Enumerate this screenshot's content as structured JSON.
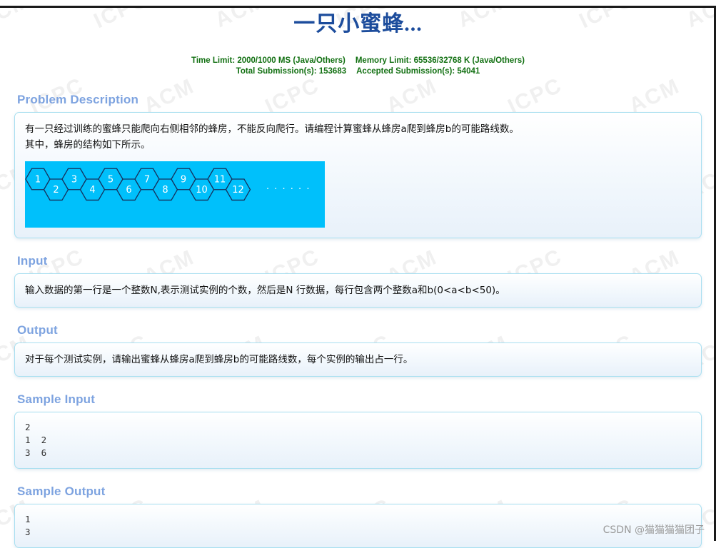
{
  "page": {
    "title": "一只小蜜蜂...",
    "title_color": "#1c4c9c",
    "background_watermark_text": "ACM ICPC",
    "csdn_watermark": "CSDN @猫猫猫猫团子"
  },
  "stats": {
    "time_limit": "Time Limit: 2000/1000 MS (Java/Others)",
    "memory_limit": "Memory Limit: 65536/32768 K (Java/Others)",
    "total_submissions": "Total Submission(s): 153683",
    "accepted_submissions": "Accepted Submission(s): 54041",
    "color": "#127012"
  },
  "sections": {
    "problem_description": {
      "heading": "Problem Description",
      "line1": "有一只经过训练的蜜蜂只能爬向右侧相邻的蜂房，不能反向爬行。请编程计算蜜蜂从蜂房a爬到蜂房b的可能路线数。",
      "line2": "其中，蜂房的结构如下所示。"
    },
    "input": {
      "heading": "Input",
      "text": "输入数据的第一行是一个整数N,表示测试实例的个数，然后是N 行数据，每行包含两个整数a和b(0<a<b<50)。"
    },
    "output": {
      "heading": "Output",
      "text": "对于每个测试实例，请输出蜜蜂从蜂房a爬到蜂房b的可能路线数，每个实例的输出占一行。"
    },
    "sample_input": {
      "heading": "Sample Input",
      "text": "2\n1  2\n3  6"
    },
    "sample_output": {
      "heading": "Sample Output",
      "text": "1\n3"
    }
  },
  "honeycomb": {
    "background_color": "#00c0fb",
    "cell_border_color": "#16305c",
    "cell_label_color": "#ffffff",
    "ellipsis": ". . . . . .",
    "top_row_labels": [
      "1",
      "3",
      "5",
      "7",
      "9",
      "11"
    ],
    "bottom_row_labels": [
      "2",
      "4",
      "6",
      "8",
      "10",
      "12"
    ]
  },
  "heading_color": "#7da3e0"
}
